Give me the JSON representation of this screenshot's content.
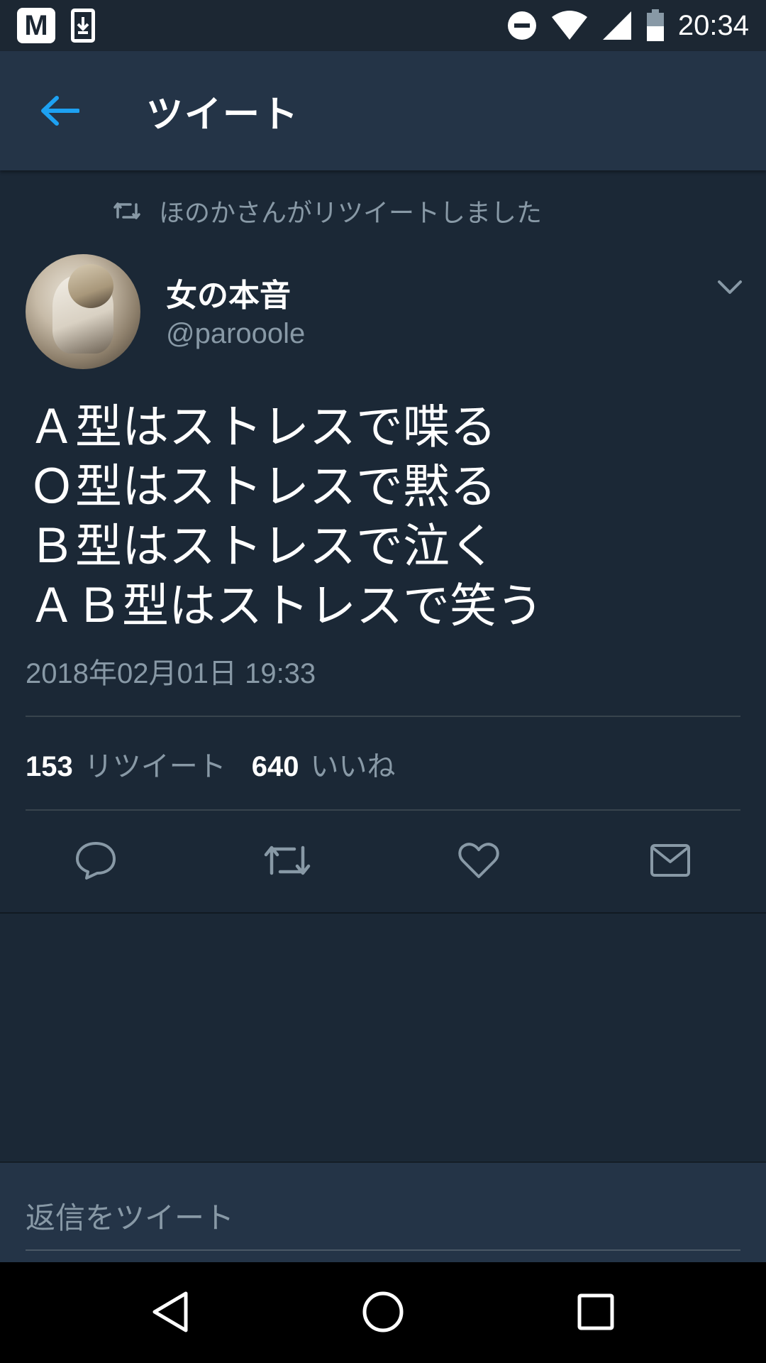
{
  "status_bar": {
    "app_badge": "M",
    "time": "20:34",
    "icons": [
      "m-app-icon",
      "download-icon",
      "do-not-disturb-icon",
      "wifi-icon",
      "signal-icon",
      "battery-icon"
    ]
  },
  "header": {
    "title": "ツイート",
    "back_icon": "back-arrow-icon"
  },
  "tweet": {
    "retweeted_by": "ほのかさんがリツイートしました",
    "author": {
      "name": "女の本音",
      "handle": "@parooole"
    },
    "lines": [
      "Ａ型はストレスで喋る",
      "Ｏ型はストレスで黙る",
      "Ｂ型はストレスで泣く",
      "ＡＢ型はストレスで笑う"
    ],
    "timestamp": "2018年02月01日 19:33",
    "stats": {
      "retweets_count": "153",
      "retweets_label": "リツイート",
      "likes_count": "640",
      "likes_label": "いいね"
    },
    "actions": [
      "reply-icon",
      "retweet-icon",
      "like-icon",
      "direct-message-icon"
    ]
  },
  "reply": {
    "placeholder": "返信をツイート"
  },
  "colors": {
    "background": "#1b2836",
    "header": "#243447",
    "accent": "#1da1f2",
    "secondary_text": "#8899a6"
  }
}
